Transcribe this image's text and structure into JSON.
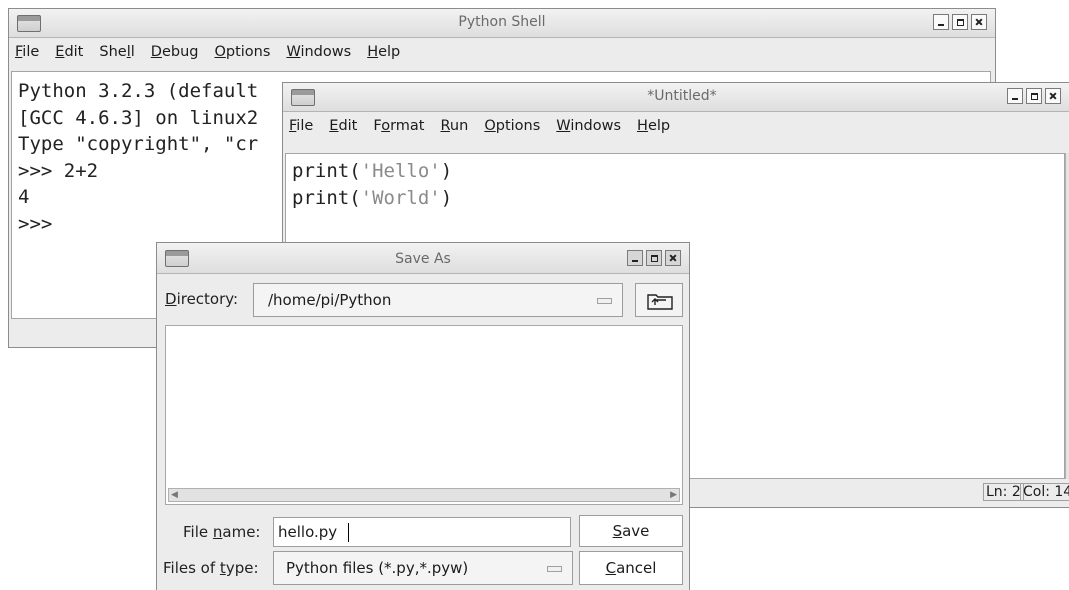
{
  "shell": {
    "title": "Python Shell",
    "menu": [
      {
        "pre": "",
        "ul": "F",
        "post": "ile"
      },
      {
        "pre": "",
        "ul": "E",
        "post": "dit"
      },
      {
        "pre": "She",
        "ul": "l",
        "post": "l"
      },
      {
        "pre": "",
        "ul": "D",
        "post": "ebug"
      },
      {
        "pre": "",
        "ul": "O",
        "post": "ptions"
      },
      {
        "pre": "",
        "ul": "W",
        "post": "indows"
      },
      {
        "pre": "",
        "ul": "H",
        "post": "elp"
      }
    ],
    "lines": [
      "Python 3.2.3 (default",
      "[GCC 4.6.3] on linux2",
      "Type \"copyright\", \"cr",
      ">>> 2+2",
      "4",
      ">>> "
    ]
  },
  "untitled": {
    "title": "*Untitled*",
    "menu": [
      {
        "pre": "",
        "ul": "F",
        "post": "ile"
      },
      {
        "pre": "",
        "ul": "E",
        "post": "dit"
      },
      {
        "pre": "F",
        "ul": "o",
        "post": "rmat"
      },
      {
        "pre": "",
        "ul": "R",
        "post": "un"
      },
      {
        "pre": "",
        "ul": "O",
        "post": "ptions"
      },
      {
        "pre": "",
        "ul": "W",
        "post": "indows"
      },
      {
        "pre": "",
        "ul": "H",
        "post": "elp"
      }
    ],
    "code": [
      {
        "fn": "print(",
        "str": "'Hello'",
        "end": ")"
      },
      {
        "fn": "print(",
        "str": "'World'",
        "end": ")"
      }
    ],
    "status_line": "Ln: 2",
    "status_col": "Col: 14"
  },
  "save_as": {
    "title": "Save As",
    "directory_label_ul": "D",
    "directory_label_rest": "irectory:",
    "directory_value": "/home/pi/Python",
    "filename_label_pre": "File ",
    "filename_label_ul": "n",
    "filename_label_post": "ame:",
    "filename_value": "hello.py",
    "filetype_label_pre": "Files of ",
    "filetype_label_ul": "t",
    "filetype_label_post": "ype:",
    "filetype_value": "Python files (*.py,*.pyw)",
    "save_ul": "S",
    "save_rest": "ave",
    "cancel_ul": "C",
    "cancel_rest": "ancel"
  }
}
